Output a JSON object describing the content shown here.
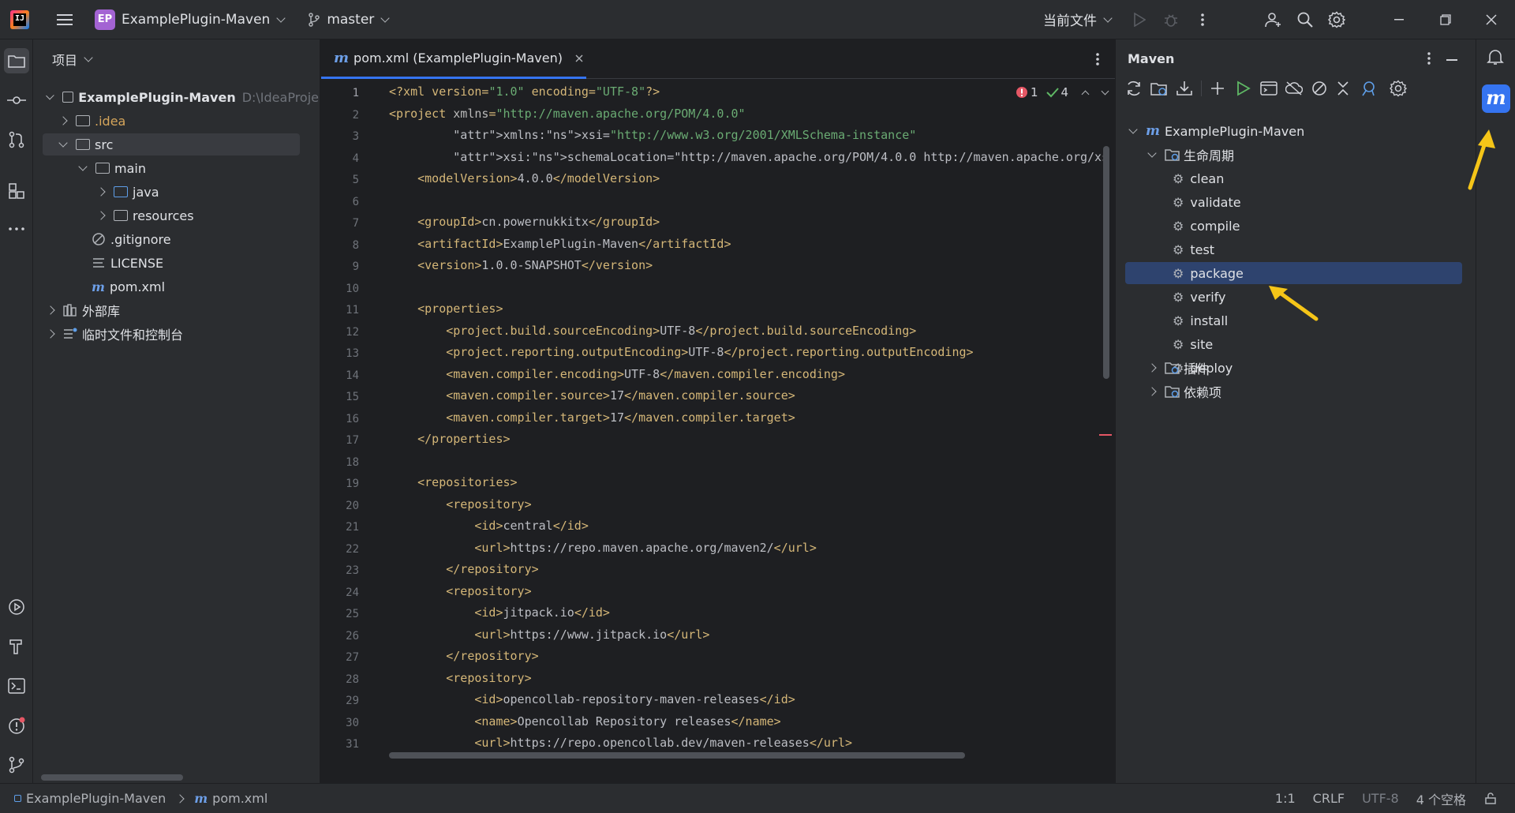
{
  "topbar": {
    "project_badge": "EP",
    "project_name": "ExamplePlugin-Maven",
    "branch": "master",
    "run_config": "当前文件"
  },
  "project_panel": {
    "title": "项目",
    "tree": [
      {
        "label": "ExamplePlugin-Maven",
        "suffix": "D:\\IdeaProje",
        "depth": 0,
        "expanded": true,
        "kind": "module"
      },
      {
        "label": ".idea",
        "depth": 1,
        "expanded": false,
        "kind": "folder",
        "color": "#d5a55b"
      },
      {
        "label": "src",
        "depth": 1,
        "expanded": true,
        "kind": "folder",
        "selected": true
      },
      {
        "label": "main",
        "depth": 2,
        "expanded": true,
        "kind": "folder"
      },
      {
        "label": "java",
        "depth": 3,
        "expanded": false,
        "kind": "folder-blue"
      },
      {
        "label": "resources",
        "depth": 3,
        "expanded": false,
        "kind": "folder-res"
      },
      {
        "label": ".gitignore",
        "depth": 1,
        "kind": "file-ignore"
      },
      {
        "label": "LICENSE",
        "depth": 1,
        "kind": "file-text"
      },
      {
        "label": "pom.xml",
        "depth": 1,
        "kind": "file-maven"
      },
      {
        "label": "外部库",
        "depth": 0,
        "expanded": false,
        "kind": "library"
      },
      {
        "label": "临时文件和控制台",
        "depth": 0,
        "expanded": false,
        "kind": "scratch"
      }
    ]
  },
  "editor": {
    "tab_label": "pom.xml (ExamplePlugin-Maven)",
    "errors": "1",
    "warnings": "4",
    "lines": [
      "<?xml version=\"1.0\" encoding=\"UTF-8\"?>",
      "<project xmlns=\"http://maven.apache.org/POM/4.0.0\"",
      "         xmlns:xsi=\"http://www.w3.org/2001/XMLSchema-instance\"",
      "         xsi:schemaLocation=\"http://maven.apache.org/POM/4.0.0 http://maven.apache.org/xsd/m",
      "    <modelVersion>4.0.0</modelVersion>",
      "",
      "    <groupId>cn.powernukkitx</groupId>",
      "    <artifactId>ExamplePlugin-Maven</artifactId>",
      "    <version>1.0.0-SNAPSHOT</version>",
      "",
      "    <properties>",
      "        <project.build.sourceEncoding>UTF-8</project.build.sourceEncoding>",
      "        <project.reporting.outputEncoding>UTF-8</project.reporting.outputEncoding>",
      "        <maven.compiler.encoding>UTF-8</maven.compiler.encoding>",
      "        <maven.compiler.source>17</maven.compiler.source>",
      "        <maven.compiler.target>17</maven.compiler.target>",
      "    </properties>",
      "",
      "    <repositories>",
      "        <repository>",
      "            <id>central</id>",
      "            <url>https://repo.maven.apache.org/maven2/</url>",
      "        </repository>",
      "        <repository>",
      "            <id>jitpack.io</id>",
      "            <url>https://www.jitpack.io</url>",
      "        </repository>",
      "        <repository>",
      "            <id>opencollab-repository-maven-releases</id>",
      "            <name>Opencollab Repository releases</name>",
      "            <url>https://repo.opencollab.dev/maven-releases</url>"
    ]
  },
  "maven_panel": {
    "title": "Maven",
    "root": "ExamplePlugin-Maven",
    "lifecycle_label": "生命周期",
    "lifecycle": [
      "clean",
      "validate",
      "compile",
      "test",
      "package",
      "verify",
      "install",
      "site",
      "deploy"
    ],
    "selected": "package",
    "plugins_label": "插件",
    "dependencies_label": "依赖项"
  },
  "statusbar": {
    "breadcrumb_project": "ExamplePlugin-Maven",
    "breadcrumb_file": "pom.xml",
    "position": "1:1",
    "line_sep": "CRLF",
    "encoding": "UTF-8",
    "indent": "4 个空格"
  },
  "colors": {
    "accent": "#3574f0",
    "annotation_arrow": "#f5c518"
  }
}
